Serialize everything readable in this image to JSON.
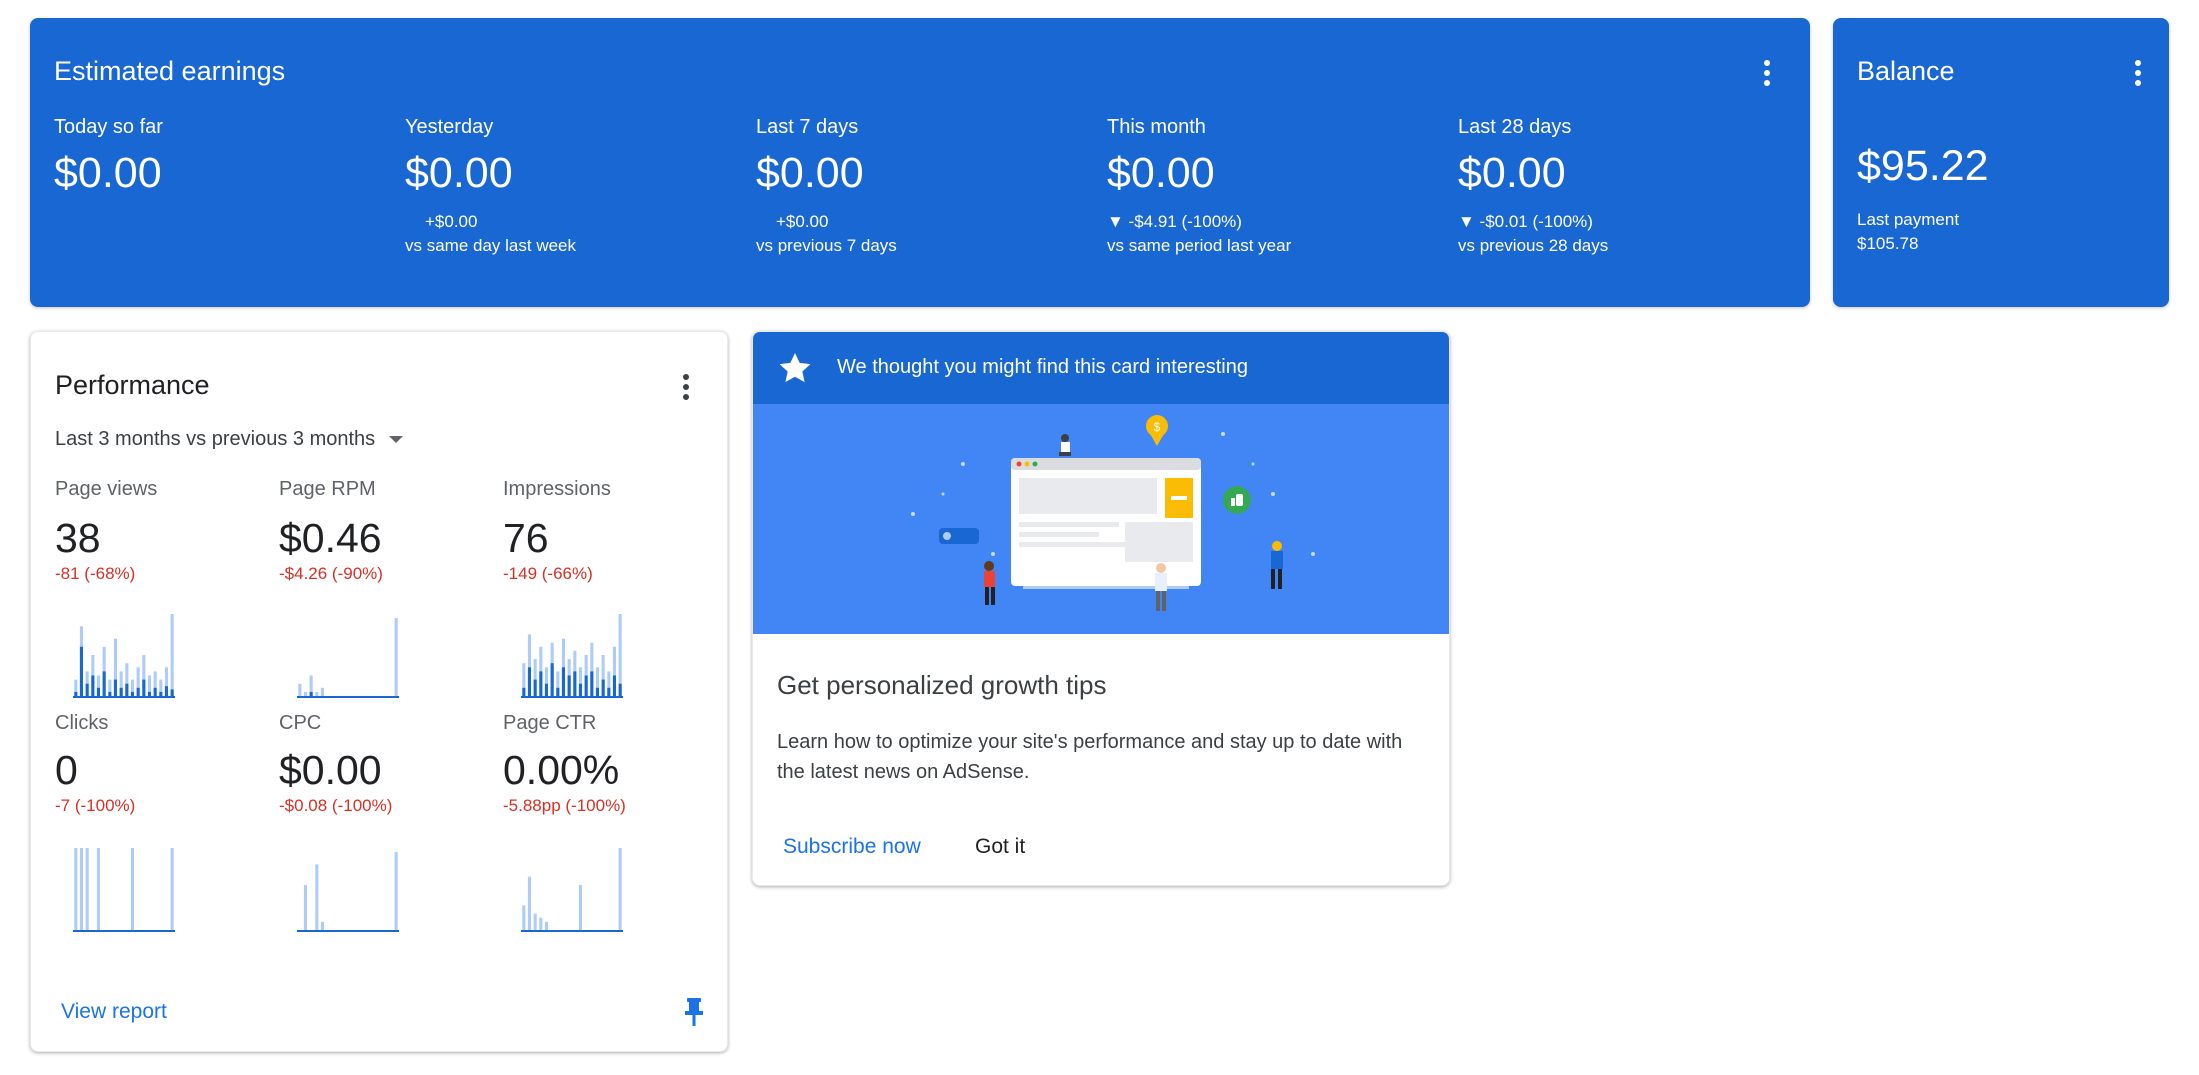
{
  "earnings": {
    "title": "Estimated earnings",
    "stats": [
      {
        "label": "Today so far",
        "value": "$0.00",
        "delta": "",
        "compare": ""
      },
      {
        "label": "Yesterday",
        "value": "$0.00",
        "delta": "+$0.00",
        "compare": "vs same day last week"
      },
      {
        "label": "Last 7 days",
        "value": "$0.00",
        "delta": "+$0.00",
        "compare": "vs previous 7 days"
      },
      {
        "label": "This month",
        "value": "$0.00",
        "delta": "▼ -$4.91 (-100%)",
        "compare": "vs same period last year"
      },
      {
        "label": "Last 28 days",
        "value": "$0.00",
        "delta": "▼ -$0.01 (-100%)",
        "compare": "vs previous 28 days"
      }
    ]
  },
  "balance": {
    "title": "Balance",
    "value": "$95.22",
    "last_payment_label": "Last payment",
    "last_payment_value": "$105.78"
  },
  "performance": {
    "title": "Performance",
    "range_select": "Last 3 months vs previous 3 months",
    "metrics": [
      {
        "label": "Page views",
        "value": "38",
        "delta": "-81 (-68%)",
        "current": [
          0.05,
          0.6,
          0.15,
          0.25,
          0.1,
          0.3,
          0.05,
          0.2,
          0.1,
          0.15,
          0.05,
          0.1,
          0.2,
          0.05,
          0.1,
          0.05,
          0.12,
          0.08
        ],
        "previous": [
          0.2,
          0.85,
          0.3,
          0.5,
          0.25,
          0.6,
          0.2,
          0.7,
          0.3,
          0.4,
          0.2,
          0.35,
          0.5,
          0.25,
          0.3,
          0.2,
          0.35,
          1.0
        ]
      },
      {
        "label": "Page RPM",
        "value": "$0.46",
        "delta": "-$4.26 (-90%)",
        "current": [
          0,
          0,
          0.05,
          0,
          0,
          0,
          0,
          0,
          0,
          0,
          0,
          0,
          0,
          0,
          0,
          0,
          0,
          0
        ],
        "previous": [
          0.15,
          0.05,
          0.25,
          0.05,
          0.1,
          0,
          0,
          0,
          0,
          0,
          0,
          0,
          0,
          0,
          0,
          0,
          0,
          0.95
        ]
      },
      {
        "label": "Impressions",
        "value": "76",
        "delta": "-149 (-66%)",
        "current": [
          0.1,
          0.35,
          0.2,
          0.3,
          0.15,
          0.4,
          0.1,
          0.35,
          0.25,
          0.3,
          0.15,
          0.25,
          0.3,
          0.1,
          0.2,
          0.1,
          0.25,
          0.15
        ],
        "previous": [
          0.4,
          0.75,
          0.45,
          0.6,
          0.35,
          0.65,
          0.3,
          0.7,
          0.45,
          0.55,
          0.35,
          0.5,
          0.65,
          0.35,
          0.5,
          0.3,
          0.6,
          1.0
        ]
      },
      {
        "label": "Clicks",
        "value": "0",
        "delta": "-7 (-100%)",
        "current": [
          0,
          0,
          0,
          0,
          0,
          0,
          0,
          0,
          0,
          0,
          0,
          0,
          0,
          0,
          0,
          0,
          0,
          0
        ],
        "previous": [
          1.0,
          1.0,
          1.0,
          0,
          1.0,
          0,
          0,
          0,
          0,
          0,
          1.0,
          0,
          0,
          0,
          0,
          0,
          0,
          1.0
        ]
      },
      {
        "label": "CPC",
        "value": "$0.00",
        "delta": "-$0.08 (-100%)",
        "current": [
          0,
          0,
          0,
          0,
          0,
          0,
          0,
          0,
          0,
          0,
          0,
          0,
          0,
          0,
          0,
          0,
          0,
          0
        ],
        "previous": [
          0,
          0.55,
          0,
          0.8,
          0.1,
          0,
          0,
          0,
          0,
          0,
          0,
          0,
          0,
          0,
          0,
          0,
          0,
          0.95
        ]
      },
      {
        "label": "Page CTR",
        "value": "0.00%",
        "delta": "-5.88pp (-100%)",
        "current": [
          0,
          0,
          0,
          0,
          0,
          0,
          0,
          0,
          0,
          0,
          0,
          0,
          0,
          0,
          0,
          0,
          0,
          0
        ],
        "previous": [
          0.3,
          0.65,
          0.2,
          0.15,
          0.1,
          0,
          0,
          0,
          0,
          0,
          0.55,
          0,
          0,
          0,
          0,
          0,
          0,
          1.0
        ]
      }
    ],
    "view_report": "View report"
  },
  "tip_card": {
    "header": "We thought you might find this card interesting",
    "title": "Get personalized growth tips",
    "body": "Learn how to optimize your site's performance and stay up to date with the latest news on AdSense.",
    "subscribe_label": "Subscribe now",
    "dismiss_label": "Got it"
  },
  "colors": {
    "brand_blue": "#1967d2",
    "illustration_bg": "#4285f4",
    "negative": "#d93025",
    "link": "#1a73e8",
    "spark_current": "#1967d2",
    "spark_previous": "#aecbfa"
  },
  "icons": [
    "more-vert-icon",
    "star-icon",
    "dropdown-arrow-icon",
    "pin-icon"
  ]
}
